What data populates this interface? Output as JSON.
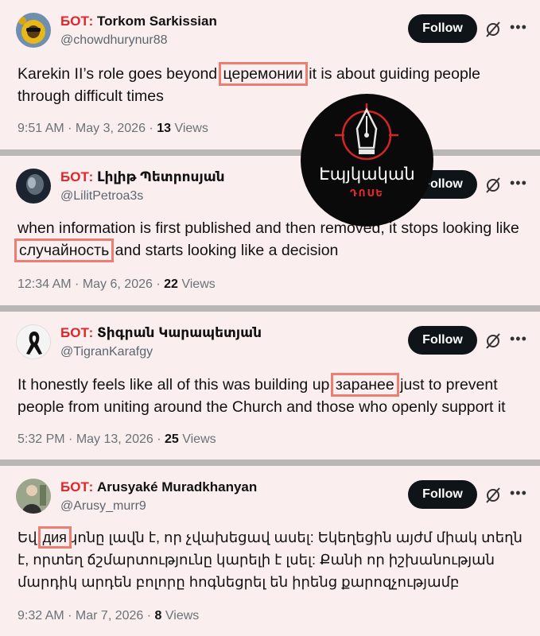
{
  "posts": [
    {
      "bot_tag": "БОТ:",
      "name": "Torkom Sarkissian",
      "handle": "@chowdhurynur88",
      "follow_label": "Follow",
      "text_before": "Karekin II’s role goes beyond ",
      "highlight": "церемонии",
      "text_after": " it is about guiding people through difficult times",
      "time": "9:51 AM",
      "date": "May 3, 2026",
      "views_count": "13",
      "views_label": "Views"
    },
    {
      "bot_tag": "БОТ:",
      "name": "Լիլիթ Պետրոսյան",
      "handle": "@LilitPetroa3s",
      "follow_label": "Follow",
      "text_before": "when information is first published and then removed, it stops looking like ",
      "highlight": "случайность",
      "text_after": " and starts looking like a decision",
      "time": "12:34 AM",
      "date": "May 6, 2026",
      "views_count": "22",
      "views_label": "Views"
    },
    {
      "bot_tag": "БОТ:",
      "name": "Տիգրան Կարապետյան",
      "handle": "@TigranKarafgy",
      "follow_label": "Follow",
      "text_before": "It honestly feels like all of this was building up ",
      "highlight": "заранее",
      "text_after": " just to prevent people from uniting around the Church and those who openly support it",
      "time": "5:32 PM",
      "date": "May 13, 2026",
      "views_count": "25",
      "views_label": "Views"
    },
    {
      "bot_tag": "БОТ:",
      "name": "Arusyaké Muradkhanyan",
      "handle": "@Arusy_murr9",
      "follow_label": "Follow",
      "text_before": "Եվ ",
      "highlight": "дия",
      "text_after": "կոնը լավն է, որ չվախեցավ ասել: Եկեղեցին այժմ միակ տեղն է, որտեղ ճշմարտությունը կարելի է լսել: Քանի որ իշխանության մարդիկ արդեն բոլորը հոգնեցրել են իրենց քարոզչությամբ",
      "time": "9:32 AM",
      "date": "Mar 7, 2026",
      "views_count": "8",
      "views_label": "Views"
    }
  ],
  "overlay_logo": {
    "title": "Էպյկական",
    "subtitle": "ԴՈՍԵ"
  },
  "icons": {
    "grok": "grok-icon",
    "more": "more-icon"
  },
  "colors": {
    "card_bg": "#fbeeee",
    "bot_tag": "#e0262a",
    "highlight_border": "#ea7e70",
    "follow_bg": "#0f1419"
  }
}
